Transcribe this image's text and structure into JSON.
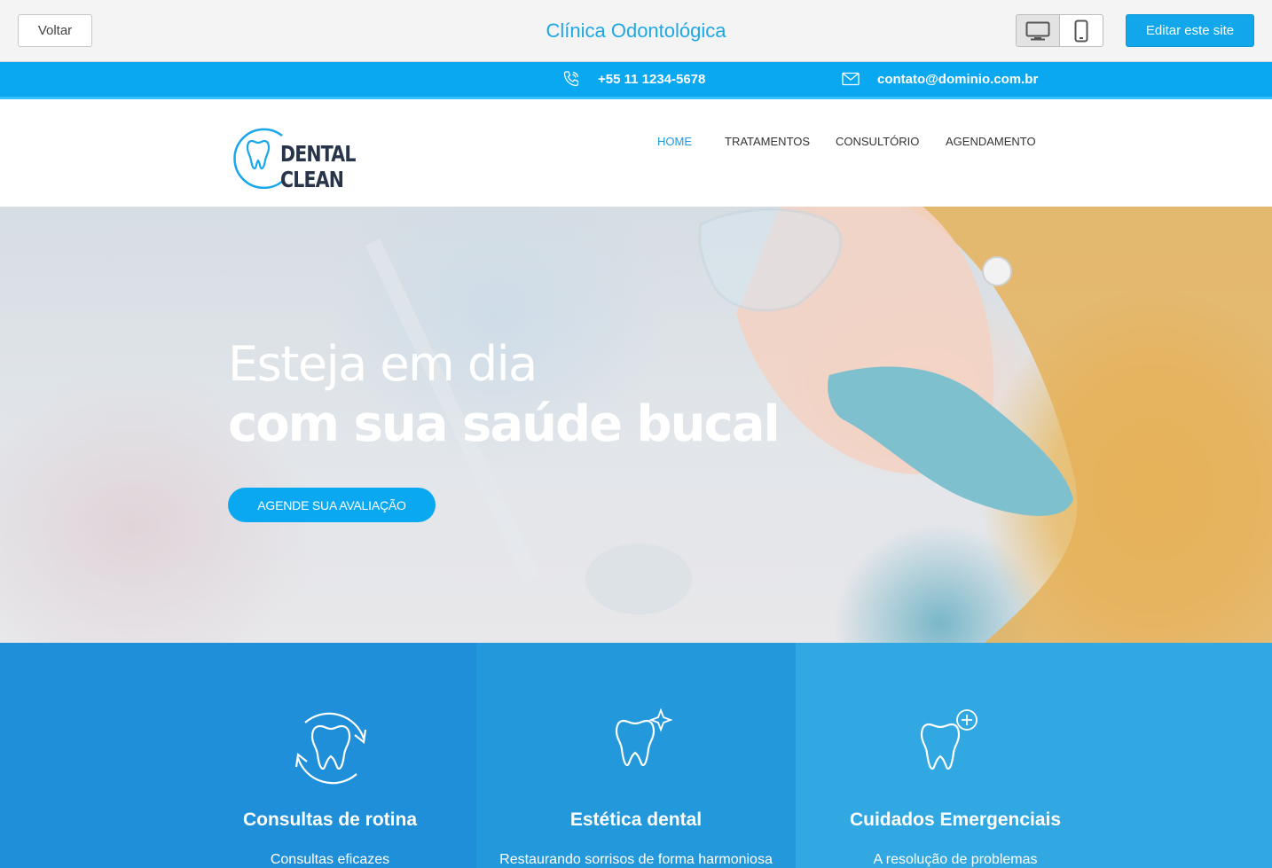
{
  "editor": {
    "back_label": "Voltar",
    "site_title": "Clínica Odontológica",
    "edit_label": "Editar este site",
    "devices": [
      "desktop-icon",
      "mobile-icon"
    ]
  },
  "contact": {
    "phone": "+55 11 1234-5678",
    "email": "contato@dominio.com.br"
  },
  "header": {
    "logo_text": "DENTAL CLEAN",
    "nav": [
      {
        "label": "HOME",
        "active": true
      },
      {
        "label": "TRATAMENTOS",
        "active": false
      },
      {
        "label": "CONSULTÓRIO",
        "active": false
      },
      {
        "label": "AGENDAMENTO",
        "active": false
      }
    ]
  },
  "hero": {
    "line1": "Esteja em dia",
    "line2": "com sua saúde bucal",
    "cta": "AGENDE SUA AVALIAÇÃO"
  },
  "features": [
    {
      "icon": "tooth-cycle-icon",
      "title": "Consultas de rotina",
      "desc": "Consultas eficazes"
    },
    {
      "icon": "tooth-sparkle-icon",
      "title": "Estética dental",
      "desc": "Restaurando sorrisos de forma harmoniosa"
    },
    {
      "icon": "tooth-plus-icon",
      "title": "Cuidados Emergenciais",
      "desc": "A resolução de problemas"
    }
  ],
  "colors": {
    "accent": "#0aa8f0",
    "title_blue": "#1ea8e3",
    "logo_dark": "#27344a",
    "feature_1": "#1e8fd8",
    "feature_2": "#2398db",
    "feature_3": "#31a8e1"
  }
}
